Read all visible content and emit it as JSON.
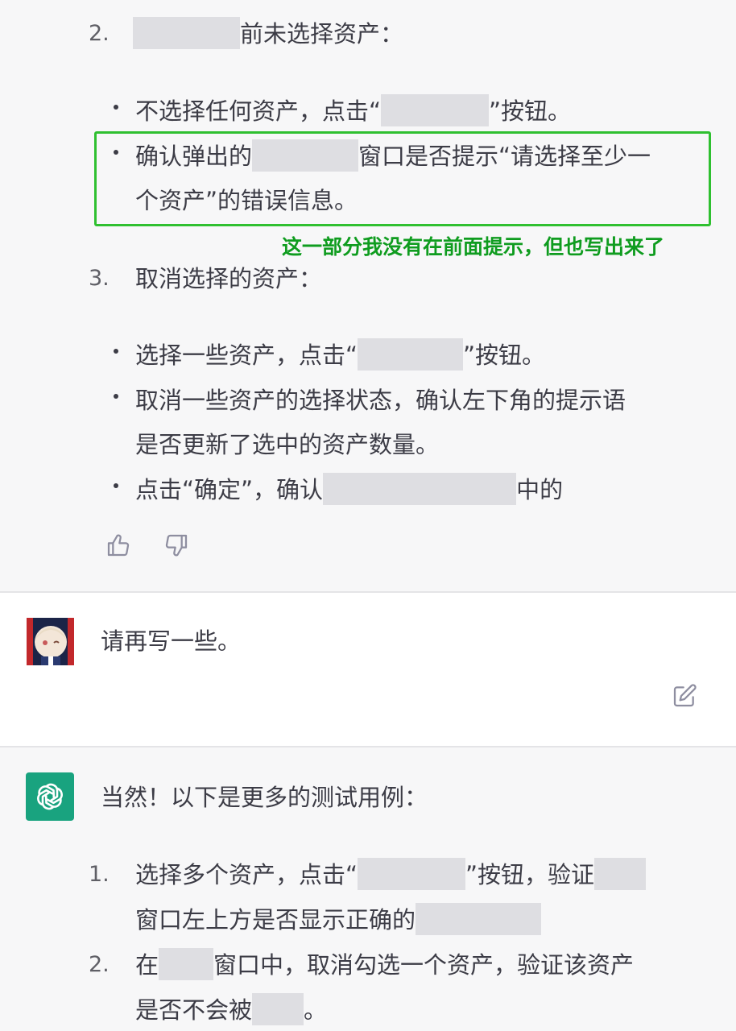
{
  "assistant_message_1": {
    "items": [
      {
        "num": "2.",
        "after": "前未选择资产："
      },
      {
        "text_before": "不选择任何资产，点击“",
        "text_after": "”按钮。"
      },
      {
        "line1_before": "确认弹出的",
        "line1_after": "窗口是否提示“请选择至少一",
        "line2": "个资产”的错误信息。"
      },
      {
        "num": "3.",
        "text": "取消选择的资产："
      },
      {
        "text_before": "选择一些资产，点击“",
        "text_after": "”按钮。"
      },
      {
        "line1": "取消一些资产的选择状态，确认左下角的提示语",
        "line2": "是否更新了选中的资产数量。"
      },
      {
        "text_before": "点击“确定”，确认",
        "text_after": "中的"
      }
    ],
    "annotation": "这一部分我没有在前面提示，但也写出来了",
    "thumbs_up_icon": "thumbs-up-icon",
    "thumbs_down_icon": "thumbs-down-icon"
  },
  "user_message": {
    "text": "请再写一些。",
    "edit_icon": "edit-icon"
  },
  "assistant_message_2": {
    "intro": "当然！以下是更多的测试用例：",
    "items": [
      {
        "num": "1.",
        "line1_before": "选择多个资产，点击“",
        "line1_mid": "”按钮，验证",
        "line2_before": "窗口左上方是否显示正确的"
      },
      {
        "num": "2.",
        "line1_before": "在",
        "line1_after": "窗口中，取消勾选一个资产，验证该资产",
        "line2_before": "是否不会被",
        "line2_after": "。"
      }
    ]
  },
  "colors": {
    "assistant_bg": "#f7f7f8",
    "highlight": "#2fc030",
    "annotation": "#0f9c1f",
    "gpt_brand": "#19a37f"
  }
}
